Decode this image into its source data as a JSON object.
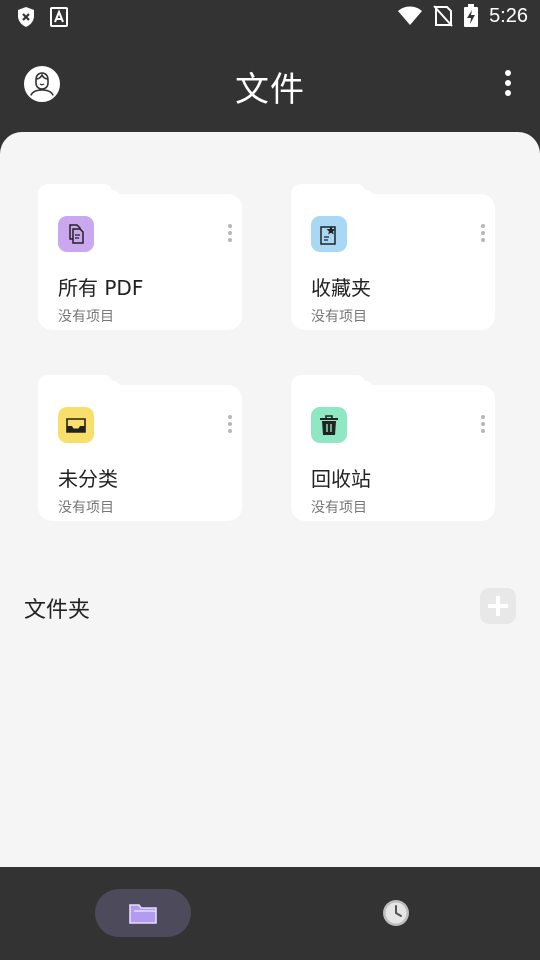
{
  "status_bar": {
    "time": "5:26",
    "icons": [
      "shield-x-icon",
      "a-font-icon",
      "wifi-icon",
      "no-sim-icon",
      "battery-charging-icon"
    ]
  },
  "header": {
    "title": "文件",
    "avatar_icon": "user-avatar-icon",
    "menu_icon": "more-vertical-icon"
  },
  "cards": [
    {
      "title": "所有 PDF",
      "subtitle": "没有项目",
      "icon": "pdf-documents-icon",
      "color": "#c9a8f0"
    },
    {
      "title": "收藏夹",
      "subtitle": "没有项目",
      "icon": "favorite-document-icon",
      "color": "#a9d8f5"
    },
    {
      "title": "未分类",
      "subtitle": "没有项目",
      "icon": "inbox-tray-icon",
      "color": "#f8df6b"
    },
    {
      "title": "回收站",
      "subtitle": "没有项目",
      "icon": "trash-icon",
      "color": "#8fe8c3"
    }
  ],
  "folders": {
    "title": "文件夹",
    "add_icon": "plus-icon"
  },
  "bottom_nav": {
    "items": [
      {
        "icon": "folder-icon",
        "selected": true,
        "accent": "#b39cf0"
      },
      {
        "icon": "clock-icon",
        "selected": false
      }
    ]
  }
}
